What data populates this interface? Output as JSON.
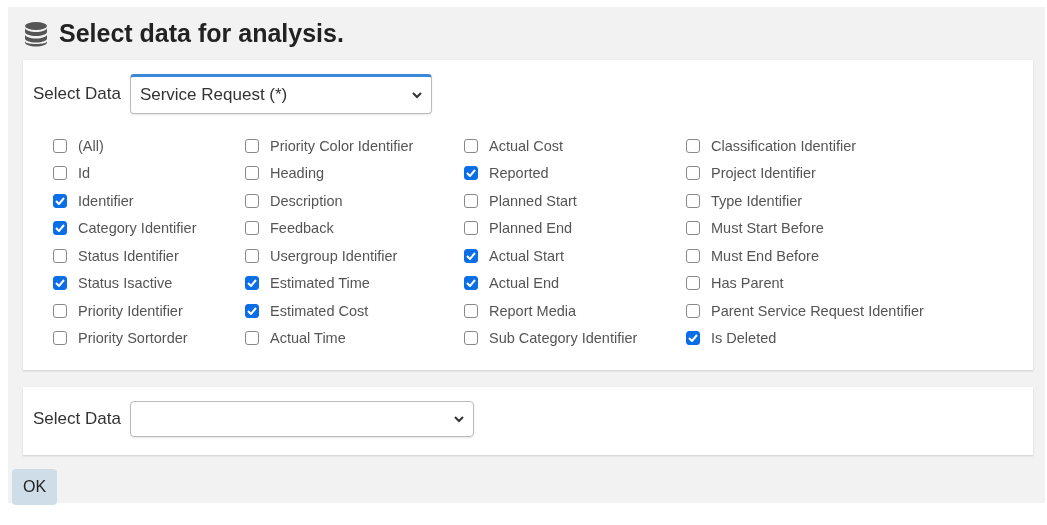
{
  "title": "Select data for analysis.",
  "panels": [
    {
      "label": "Select Data",
      "select": {
        "value": "Service Request (*)",
        "focused": true
      },
      "checkbox_columns": [
        [
          {
            "label": "(All)",
            "checked": false
          },
          {
            "label": "Id",
            "checked": false
          },
          {
            "label": "Identifier",
            "checked": true
          },
          {
            "label": "Category Identifier",
            "checked": true
          },
          {
            "label": "Status Identifier",
            "checked": false
          },
          {
            "label": "Status Isactive",
            "checked": true
          },
          {
            "label": "Priority Identifier",
            "checked": false
          },
          {
            "label": "Priority Sortorder",
            "checked": false
          }
        ],
        [
          {
            "label": "Priority Color Identifier",
            "checked": false
          },
          {
            "label": "Heading",
            "checked": false
          },
          {
            "label": "Description",
            "checked": false
          },
          {
            "label": "Feedback",
            "checked": false
          },
          {
            "label": "Usergroup Identifier",
            "checked": false
          },
          {
            "label": "Estimated Time",
            "checked": true
          },
          {
            "label": "Estimated Cost",
            "checked": true
          },
          {
            "label": "Actual Time",
            "checked": false
          }
        ],
        [
          {
            "label": "Actual Cost",
            "checked": false
          },
          {
            "label": "Reported",
            "checked": true
          },
          {
            "label": "Planned Start",
            "checked": false
          },
          {
            "label": "Planned End",
            "checked": false
          },
          {
            "label": "Actual Start",
            "checked": true
          },
          {
            "label": "Actual End",
            "checked": true
          },
          {
            "label": "Report Media",
            "checked": false
          },
          {
            "label": "Sub Category Identifier",
            "checked": false
          }
        ],
        [
          {
            "label": "Classification Identifier",
            "checked": false
          },
          {
            "label": "Project Identifier",
            "checked": false
          },
          {
            "label": "Type Identifier",
            "checked": false
          },
          {
            "label": "Must Start Before",
            "checked": false
          },
          {
            "label": "Must End Before",
            "checked": false
          },
          {
            "label": "Has Parent",
            "checked": false
          },
          {
            "label": "Parent Service Request Identifier",
            "checked": false
          },
          {
            "label": "Is Deleted",
            "checked": true
          }
        ]
      ]
    },
    {
      "label": "Select Data",
      "select": {
        "focused": false
      }
    }
  ],
  "buttons": [
    "OK"
  ]
}
